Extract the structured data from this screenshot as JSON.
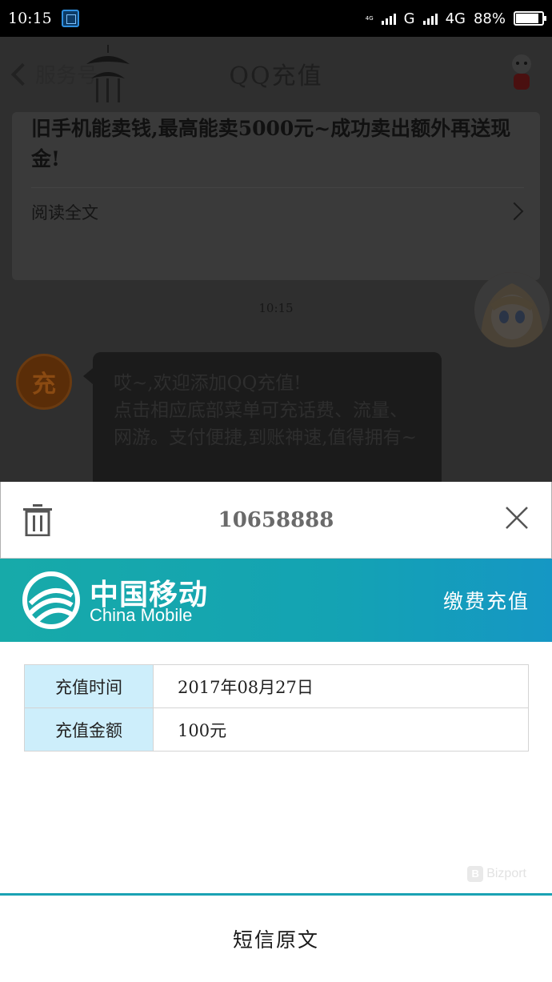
{
  "status_bar": {
    "time": "10:15",
    "network_small": "4G",
    "network1": "G",
    "network2": "4G",
    "battery": "88%",
    "battery_level": 0.88
  },
  "chat": {
    "back_label": "服务号",
    "title": "QQ充值",
    "article": {
      "text": "旧手机能卖钱,最高能卖5000元~成功卖出额外再送现金!",
      "read_more": "阅读全文"
    },
    "timestamp": "10:15",
    "bot_avatar_char": "充",
    "bot_message": "哎~,欢迎添加QQ充值!\n点击相应底部菜单可充话费、流量、网游。支付便捷,到账神速,值得拥有~"
  },
  "sms_sheet": {
    "sender": "10658888",
    "banner": {
      "brand_cn": "中国移动",
      "brand_en": "China Mobile",
      "service": "缴费充值"
    },
    "rows": [
      {
        "label": "充值时间",
        "value": "2017年08月27日"
      },
      {
        "label": "充值金额",
        "value": "100元"
      }
    ],
    "watermark": "Bizport",
    "original_sms_label": "短信原文"
  }
}
